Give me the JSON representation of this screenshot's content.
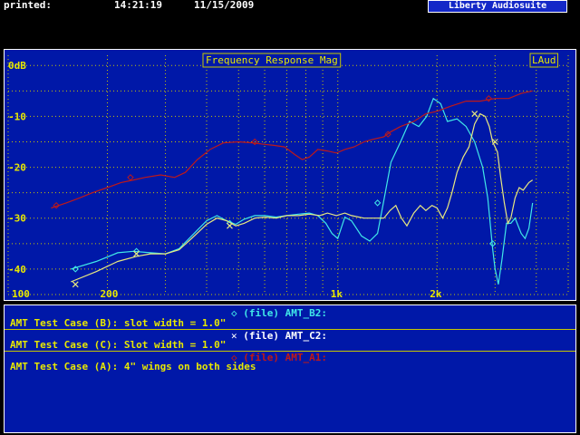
{
  "header": {
    "printed_label": "printed:",
    "time": "14:21:19",
    "date": "11/15/2009",
    "brand": "Liberty Audiosuite"
  },
  "chart_data": {
    "type": "line",
    "title": "Frequency Response Mag",
    "badge": "LAud",
    "xscale": "log",
    "xlim": [
      100,
      5000
    ],
    "ylim": [
      -45,
      2
    ],
    "grid": true,
    "y_ticks": [
      {
        "v": 0,
        "label": "0dB"
      },
      {
        "v": -10,
        "label": "-10"
      },
      {
        "v": -20,
        "label": "-20"
      },
      {
        "v": -30,
        "label": "-30"
      },
      {
        "v": -40,
        "label": "-40"
      }
    ],
    "x_ticks": [
      {
        "v": 100,
        "label": "100"
      },
      {
        "v": 200,
        "label": "200"
      },
      {
        "v": 1000,
        "label": "1k"
      },
      {
        "v": 2000,
        "label": "2k"
      }
    ],
    "series": [
      {
        "name": "AMT_B2",
        "color": "#40e8e8",
        "marker": "diamond",
        "points": [
          [
            155,
            -40
          ],
          [
            185,
            -38.5
          ],
          [
            215,
            -36.8
          ],
          [
            240,
            -36.5
          ],
          [
            270,
            -36.8
          ],
          [
            300,
            -37
          ],
          [
            330,
            -36
          ],
          [
            360,
            -33.5
          ],
          [
            400,
            -30.5
          ],
          [
            430,
            -29.5
          ],
          [
            460,
            -30.5
          ],
          [
            490,
            -31.2
          ],
          [
            520,
            -30.2
          ],
          [
            560,
            -29.5
          ],
          [
            600,
            -29.5
          ],
          [
            650,
            -29.8
          ],
          [
            700,
            -29.5
          ],
          [
            760,
            -29.2
          ],
          [
            820,
            -29
          ],
          [
            870,
            -29.5
          ],
          [
            920,
            -31
          ],
          [
            960,
            -33
          ],
          [
            1000,
            -34
          ],
          [
            1050,
            -29.8
          ],
          [
            1100,
            -30.5
          ],
          [
            1180,
            -33.5
          ],
          [
            1250,
            -34.5
          ],
          [
            1320,
            -33
          ],
          [
            1370,
            -27.5
          ],
          [
            1450,
            -19
          ],
          [
            1550,
            -15
          ],
          [
            1650,
            -11
          ],
          [
            1760,
            -12
          ],
          [
            1860,
            -10
          ],
          [
            1950,
            -6.5
          ],
          [
            2050,
            -7.5
          ],
          [
            2150,
            -11
          ],
          [
            2300,
            -10.5
          ],
          [
            2450,
            -12
          ],
          [
            2600,
            -15
          ],
          [
            2750,
            -20
          ],
          [
            2850,
            -26
          ],
          [
            2950,
            -36
          ],
          [
            3000,
            -40
          ],
          [
            3070,
            -43
          ],
          [
            3150,
            -38
          ],
          [
            3250,
            -31
          ],
          [
            3350,
            -31
          ],
          [
            3450,
            -30
          ],
          [
            3600,
            -33
          ],
          [
            3700,
            -34
          ],
          [
            3800,
            -32
          ],
          [
            3900,
            -27
          ]
        ],
        "markers": [
          [
            160,
            -40
          ],
          [
            245,
            -36.5
          ],
          [
            470,
            -31
          ],
          [
            1320,
            -27
          ],
          [
            2950,
            -35
          ]
        ]
      },
      {
        "name": "AMT_C2",
        "color": "#e8e880",
        "marker": "x",
        "points": [
          [
            155,
            -42.5
          ],
          [
            185,
            -40.5
          ],
          [
            215,
            -38.5
          ],
          [
            245,
            -37.5
          ],
          [
            270,
            -37
          ],
          [
            300,
            -37
          ],
          [
            330,
            -36.2
          ],
          [
            360,
            -34
          ],
          [
            400,
            -31.2
          ],
          [
            430,
            -30
          ],
          [
            460,
            -30.5
          ],
          [
            490,
            -31.5
          ],
          [
            520,
            -31
          ],
          [
            560,
            -30
          ],
          [
            600,
            -29.8
          ],
          [
            650,
            -30
          ],
          [
            700,
            -29.5
          ],
          [
            760,
            -29.5
          ],
          [
            820,
            -29.2
          ],
          [
            880,
            -29.5
          ],
          [
            930,
            -29
          ],
          [
            990,
            -29.5
          ],
          [
            1050,
            -29
          ],
          [
            1100,
            -29.5
          ],
          [
            1200,
            -30
          ],
          [
            1300,
            -30
          ],
          [
            1380,
            -30
          ],
          [
            1440,
            -28.5
          ],
          [
            1500,
            -27.5
          ],
          [
            1560,
            -30
          ],
          [
            1620,
            -31.5
          ],
          [
            1700,
            -29
          ],
          [
            1780,
            -27.5
          ],
          [
            1850,
            -28.5
          ],
          [
            1930,
            -27.5
          ],
          [
            2000,
            -28
          ],
          [
            2080,
            -30
          ],
          [
            2150,
            -28
          ],
          [
            2220,
            -25
          ],
          [
            2300,
            -21
          ],
          [
            2400,
            -18
          ],
          [
            2500,
            -16
          ],
          [
            2600,
            -11.5
          ],
          [
            2700,
            -9.5
          ],
          [
            2800,
            -10
          ],
          [
            2880,
            -12
          ],
          [
            2950,
            -15
          ],
          [
            3050,
            -17
          ],
          [
            3120,
            -22
          ],
          [
            3200,
            -27
          ],
          [
            3280,
            -31
          ],
          [
            3350,
            -30
          ],
          [
            3450,
            -26
          ],
          [
            3550,
            -24
          ],
          [
            3650,
            -24.5
          ],
          [
            3800,
            -23
          ],
          [
            3900,
            -22.5
          ]
        ],
        "markers": [
          [
            160,
            -43
          ],
          [
            245,
            -37
          ],
          [
            470,
            -31.5
          ],
          [
            2600,
            -9.5
          ],
          [
            3000,
            -15
          ]
        ]
      },
      {
        "name": "AMT_A1",
        "color": "#c01818",
        "marker": "diamond",
        "points": [
          [
            135,
            -28
          ],
          [
            150,
            -27
          ],
          [
            165,
            -26
          ],
          [
            180,
            -25
          ],
          [
            200,
            -24
          ],
          [
            220,
            -23
          ],
          [
            240,
            -22.5
          ],
          [
            260,
            -22
          ],
          [
            290,
            -21.5
          ],
          [
            320,
            -22
          ],
          [
            345,
            -21
          ],
          [
            375,
            -18.5
          ],
          [
            410,
            -16.5
          ],
          [
            450,
            -15.2
          ],
          [
            500,
            -15
          ],
          [
            550,
            -15.2
          ],
          [
            600,
            -15.5
          ],
          [
            640,
            -15.7
          ],
          [
            690,
            -16
          ],
          [
            740,
            -17.5
          ],
          [
            780,
            -18.5
          ],
          [
            820,
            -18
          ],
          [
            870,
            -16.5
          ],
          [
            930,
            -16.8
          ],
          [
            990,
            -17.2
          ],
          [
            1050,
            -16.5
          ],
          [
            1120,
            -16
          ],
          [
            1200,
            -15
          ],
          [
            1280,
            -14.5
          ],
          [
            1380,
            -14
          ],
          [
            1450,
            -13
          ],
          [
            1550,
            -12
          ],
          [
            1700,
            -11
          ],
          [
            1850,
            -9.5
          ],
          [
            2000,
            -9
          ],
          [
            2200,
            -8
          ],
          [
            2450,
            -7
          ],
          [
            2700,
            -7
          ],
          [
            3000,
            -6.5
          ],
          [
            3300,
            -6.5
          ],
          [
            3600,
            -5.5
          ],
          [
            3900,
            -5
          ]
        ],
        "markers": [
          [
            140,
            -27.5
          ],
          [
            235,
            -22
          ],
          [
            560,
            -15
          ],
          [
            1420,
            -13.5
          ],
          [
            2870,
            -6.5
          ]
        ]
      }
    ]
  },
  "legend": {
    "b_label": "◇ (file) AMT_B2:",
    "b_desc": "AMT Test Case (B): slot width = 1.0\"",
    "c_label": "✕ (file) AMT_C2:",
    "c_desc": "AMT Test Case (C): Slot width = 1.0\"",
    "a_label": "◇ (file) AMT_A1:",
    "a_desc": "AMT Test Case (A): 4\" wings on both sides",
    "colors": {
      "b": "#40e8e8",
      "c": "#ffffff",
      "a": "#c01818",
      "text": "#e8e800"
    }
  }
}
